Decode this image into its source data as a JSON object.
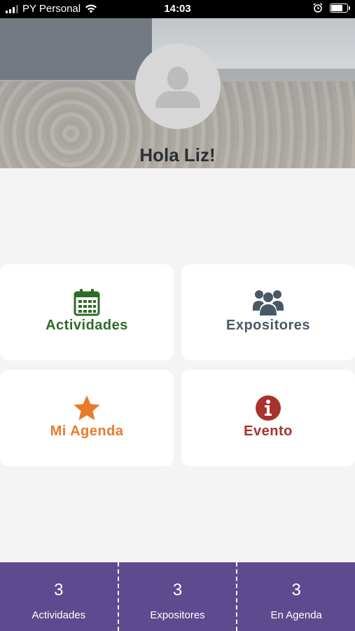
{
  "status_bar": {
    "carrier": "PY Personal",
    "time": "14:03"
  },
  "header": {
    "greeting": "Hola Liz!"
  },
  "menu": {
    "actividades": {
      "label": "Actividades",
      "icon": "calendar-icon",
      "color": "#2e6b2a"
    },
    "expositores": {
      "label": "Expositores",
      "icon": "users-icon",
      "color": "#4a5866"
    },
    "agenda": {
      "label": "Mi Agenda",
      "icon": "star-icon",
      "color": "#ea7a2a"
    },
    "evento": {
      "label": "Evento",
      "icon": "info-icon",
      "color": "#a8322c"
    }
  },
  "footer": {
    "stats": [
      {
        "value": "3",
        "label": "Actividades"
      },
      {
        "value": "3",
        "label": "Expositores"
      },
      {
        "value": "3",
        "label": "En Agenda"
      }
    ],
    "background": "#5e4a8e"
  }
}
